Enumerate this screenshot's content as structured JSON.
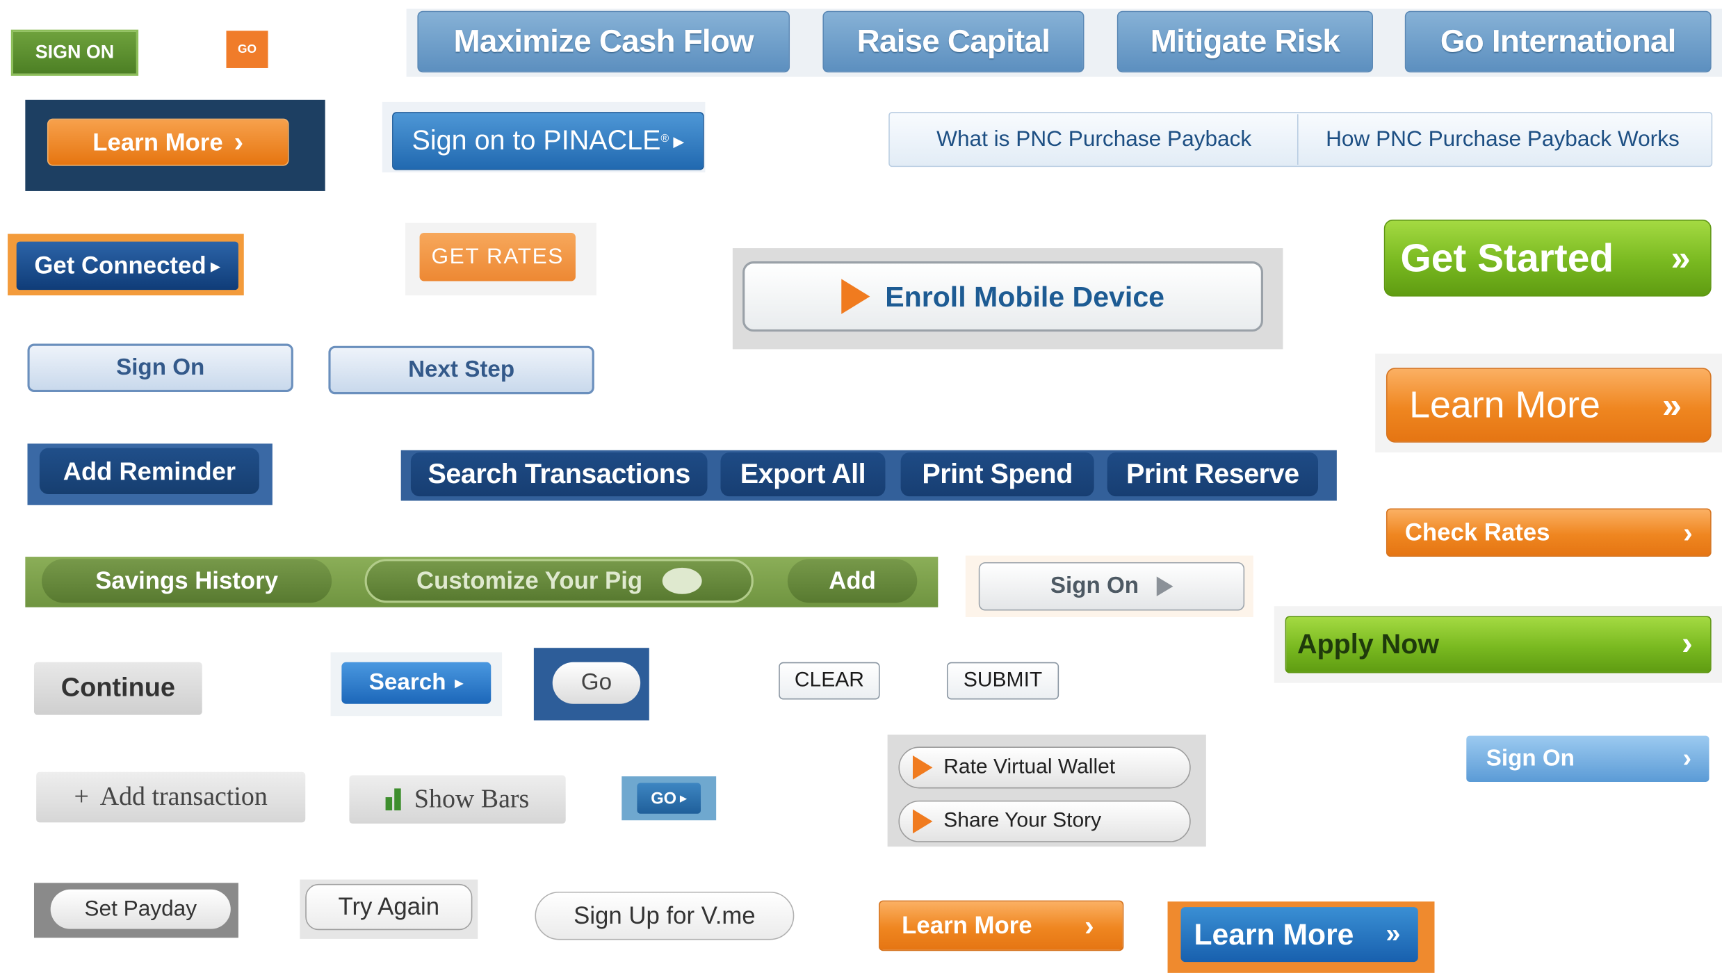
{
  "buttons": {
    "sign_on_green": "SIGN ON",
    "go_orange_small": "GO",
    "maximize_cash_flow": "Maximize Cash Flow",
    "raise_capital": "Raise Capital",
    "mitigate_risk": "Mitigate Risk",
    "go_international": "Go International",
    "learn_more_navy": "Learn More",
    "sign_on_pinacle": "Sign on to PINACLE",
    "pinacle_reg": "®",
    "what_is_pnc": "What is PNC Purchase Payback",
    "how_pnc_works": "How PNC Purchase Payback Works",
    "get_connected": "Get Connected",
    "get_rates": "GET RATES",
    "enroll_mobile_device": "Enroll Mobile Device",
    "get_started": "Get Started",
    "sign_on_blue_outline": "Sign On",
    "next_step": "Next Step",
    "learn_more_orange_large": "Learn More",
    "add_reminder": "Add Reminder",
    "search_transactions": "Search Transactions",
    "export_all": "Export All",
    "print_spend": "Print Spend",
    "print_reserve": "Print Reserve",
    "check_rates": "Check Rates",
    "savings_history": "Savings History",
    "customize_your_pig": "Customize Your Pig",
    "add": "Add",
    "sign_on_gray_arrow": "Sign On",
    "apply_now": "Apply Now",
    "continue": "Continue",
    "search": "Search",
    "go_dark": "Go",
    "clear": "CLEAR",
    "submit": "SUBMIT",
    "rate_virtual_wallet": "Rate Virtual Wallet",
    "share_your_story": "Share Your Story",
    "sign_on_light_blue": "Sign On",
    "add_transaction": "Add transaction",
    "add_transaction_plus": "+",
    "show_bars": "Show Bars",
    "go_blue_small": "GO",
    "set_payday": "Set Payday",
    "try_again": "Try Again",
    "sign_up_vme": "Sign Up for V.me",
    "learn_more_orange_small": "Learn More",
    "learn_more_blue": "Learn More"
  },
  "glyphs": {
    "chevron": "›",
    "double_chevron": "»",
    "triangle": "▸",
    "play": "▶"
  },
  "icons": [
    "chevron-right-icon",
    "double-chevron-icon",
    "play-triangle-icon",
    "pig-icon",
    "bar-chart-icon"
  ],
  "colors": {
    "pnc_orange": "#ef8620",
    "pnc_navy": "#1e4b85",
    "pnc_green": "#79b920",
    "tab_blue": "#6d9ecb"
  }
}
